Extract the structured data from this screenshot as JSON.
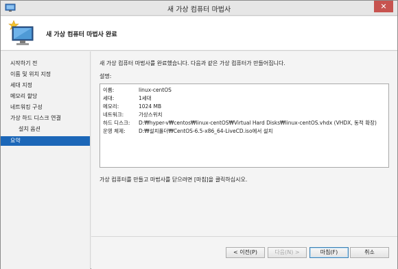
{
  "window": {
    "title": "새 가상 컴퓨터 마법사",
    "close_symbol": "✕"
  },
  "header": {
    "title": "새 가상 컴퓨터 마법사 완료",
    "icon": "vm-wizard-sparkle-icon"
  },
  "nav": {
    "items": [
      {
        "label": "시작하기 전"
      },
      {
        "label": "이름 및 위치 지정"
      },
      {
        "label": "세대 지정"
      },
      {
        "label": "메모리 할당"
      },
      {
        "label": "네트워킹 구성"
      },
      {
        "label": "가상 하드 디스크 연결"
      },
      {
        "label": "설치 옵션"
      },
      {
        "label": "요약"
      }
    ],
    "selected": "요약"
  },
  "main": {
    "intro": "새 가상 컴퓨터 마법사를 완료했습니다. 다음과 같은 가상 컴퓨터가 만들어집니다.",
    "description_label": "설명:",
    "summary": [
      {
        "key": "이름:",
        "value": "linux-centOS"
      },
      {
        "key": "세대:",
        "value": "1세대"
      },
      {
        "key": "메모리:",
        "value": "1024 MB"
      },
      {
        "key": "네트워크:",
        "value": "가상스위치"
      },
      {
        "key": "하드 디스크:",
        "value": "D:₩hyper-v₩centos₩linux-centOS₩Virtual Hard Disks₩linux-centOS.vhdx (VHDX, 동적 확장)"
      },
      {
        "key": "운영 체제:",
        "value": "D:₩설치폴더₩CentOS-6.5-x86_64-LiveCD.iso에서 설치"
      }
    ],
    "footer_note": "가상 컴퓨터를 만들고 마법사를 닫으려면 [마침]을 클릭하십시오."
  },
  "buttons": {
    "prev": "< 이전(P)",
    "next": "다음(N) >",
    "finish": "마침(F)",
    "cancel": "취소"
  },
  "colors": {
    "selected_nav": "#1c67b8",
    "close_button": "#c7534f"
  }
}
